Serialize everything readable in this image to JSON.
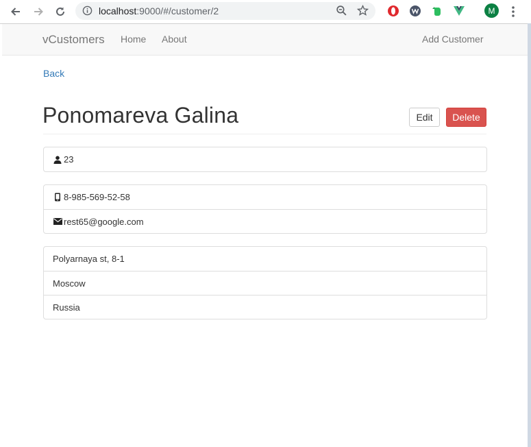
{
  "browser": {
    "url_host": "localhost",
    "url_path": ":9000/#/customer/2",
    "profile_initial": "M"
  },
  "navbar": {
    "brand": "vCustomers",
    "links": [
      "Home",
      "About"
    ],
    "add_customer": "Add Customer"
  },
  "page": {
    "back": "Back",
    "title": "Ponomareva Galina",
    "edit_label": "Edit",
    "delete_label": "Delete"
  },
  "customer": {
    "age": "23",
    "phone": "8-985-569-52-58",
    "email": "rest65@google.com",
    "address": "Polyarnaya st, 8-1",
    "city": "Moscow",
    "country": "Russia"
  },
  "colors": {
    "link": "#337ab7",
    "danger": "#d9534f",
    "navbar_bg": "#f8f8f8"
  },
  "icons": {
    "age": "user-icon",
    "phone": "phone-icon",
    "email": "envelope-icon"
  }
}
